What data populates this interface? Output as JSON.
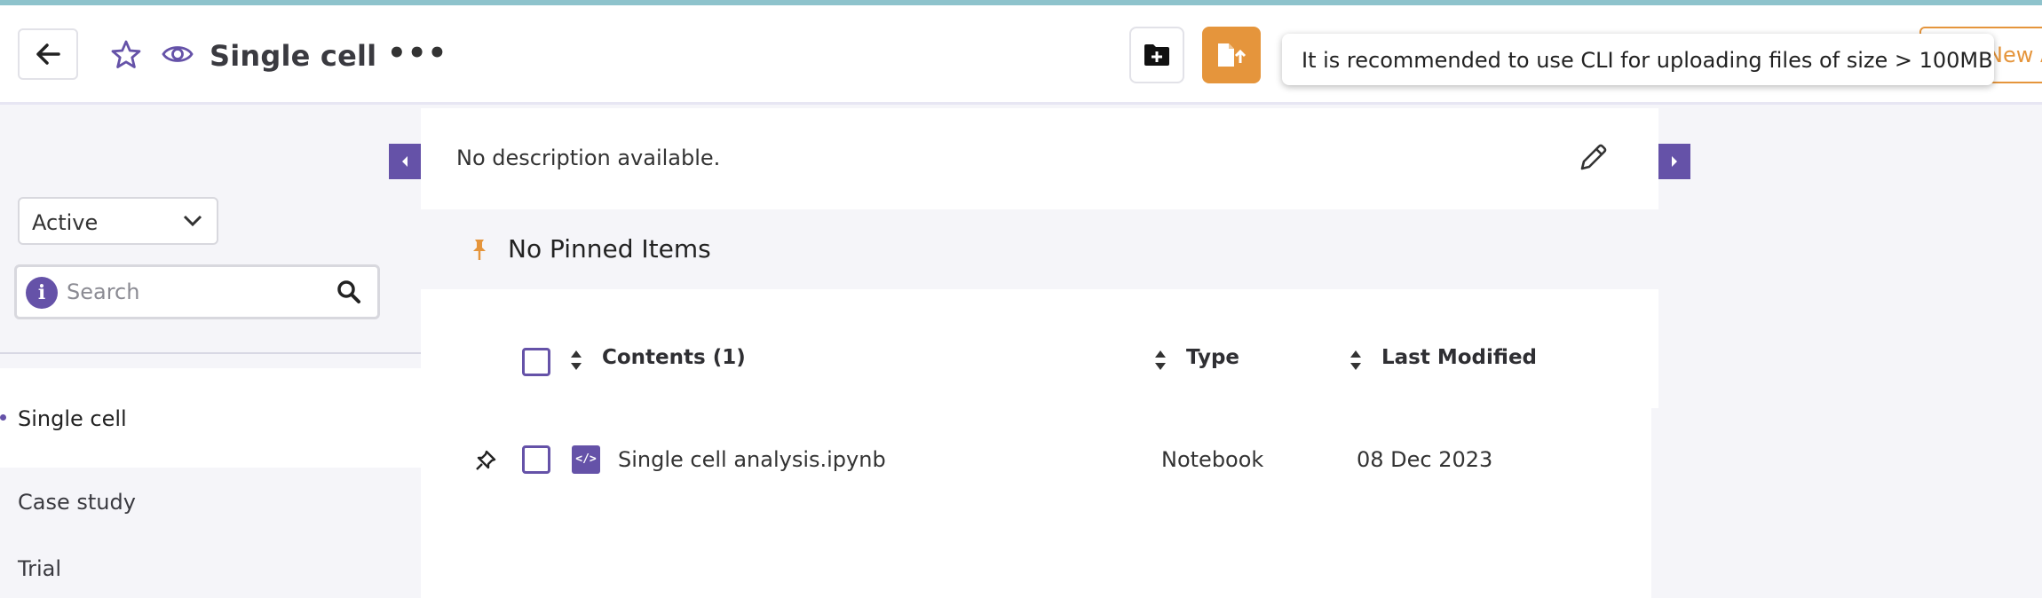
{
  "header": {
    "title": "Single cell",
    "more_label": "•••",
    "new_button_label": "New A",
    "tooltip": "It is recommended to use CLI for uploading files of size > 100MB"
  },
  "sidebar": {
    "status_select": {
      "value": "Active"
    },
    "search": {
      "placeholder": "Search",
      "info_label": "i"
    },
    "items": [
      {
        "label": "Single cell",
        "active": true
      },
      {
        "label": "Case study",
        "active": false
      },
      {
        "label": "Trial",
        "active": false
      }
    ]
  },
  "main": {
    "description": "No description available.",
    "pinned_label": "No Pinned Items",
    "table": {
      "columns": [
        "Contents (1)",
        "Type",
        "Last Modified"
      ],
      "rows": [
        {
          "name": "Single cell analysis.ipynb",
          "type": "Notebook",
          "modified": "08 Dec 2023",
          "icon": "notebook-icon"
        }
      ]
    }
  },
  "colors": {
    "accent": "#6552a8",
    "upload": "#e5953c"
  }
}
